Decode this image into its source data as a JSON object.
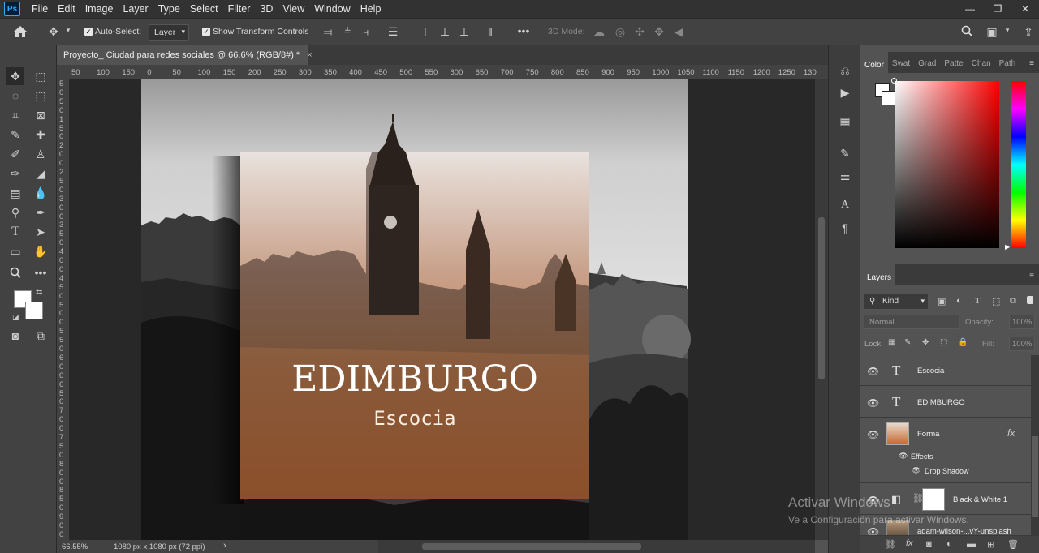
{
  "menubar": {
    "app_logo": "Ps",
    "items": [
      "File",
      "Edit",
      "Image",
      "Layer",
      "Type",
      "Select",
      "Filter",
      "3D",
      "View",
      "Window",
      "Help"
    ]
  },
  "options": {
    "auto_select_label": "Auto-Select:",
    "auto_select_value": "Layer",
    "show_transform_label": "Show Transform Controls",
    "mode_3d_label": "3D Mode:"
  },
  "document": {
    "tab_title": "Proyecto_ Ciudad para redes sociales @ 66.6% (RGB/8#) *",
    "close_glyph": "×",
    "zoom": "66.55%",
    "size_info": "1080 px x 1080 px (72 ppi)"
  },
  "ruler_h": [
    "50",
    "100",
    "150",
    "0",
    "50",
    "100",
    "150",
    "200",
    "250",
    "300",
    "350",
    "400",
    "450",
    "500",
    "550",
    "600",
    "650",
    "700",
    "750",
    "800",
    "850",
    "900",
    "950",
    "1000",
    "1050",
    "1100",
    "1150",
    "1200",
    "1250",
    "130"
  ],
  "ruler_v": [
    "5",
    "0",
    "5",
    "0",
    "1",
    "5",
    "0",
    "2",
    "0",
    "0",
    "2",
    "5",
    "0",
    "3",
    "0",
    "0",
    "3",
    "5",
    "0",
    "4",
    "0",
    "0",
    "4",
    "5",
    "0",
    "5",
    "0",
    "0",
    "5",
    "5",
    "0",
    "6",
    "0",
    "0",
    "6",
    "5",
    "0",
    "7",
    "0",
    "0",
    "7",
    "5",
    "0",
    "8",
    "0",
    "0",
    "8",
    "5",
    "0",
    "9",
    "0",
    "0"
  ],
  "artwork": {
    "title": "EDIMBURGO",
    "subtitle": "Escocia"
  },
  "color_panel": {
    "tabs": [
      "Color",
      "Swat",
      "Grad",
      "Patte",
      "Chan",
      "Path"
    ]
  },
  "layers_panel": {
    "title": "Layers",
    "filter_kind": "Kind",
    "blend_mode": "Normal",
    "opacity_label": "Opacity:",
    "opacity_value": "100%",
    "lock_label": "Lock:",
    "fill_label": "Fill:",
    "fill_value": "100%",
    "layers": [
      {
        "name": "Escocia",
        "type": "text"
      },
      {
        "name": "EDIMBURGO",
        "type": "text"
      },
      {
        "name": "Forma",
        "type": "shape",
        "fx": "fx"
      },
      {
        "name": "Black & White 1",
        "type": "adjustment"
      },
      {
        "name": "adam-wilson-...vY-unsplash",
        "type": "image"
      }
    ],
    "effects_label": "Effects",
    "drop_shadow_label": "Drop Shadow"
  },
  "watermark": {
    "line1": "Activar Windows",
    "line2": "Ve a Configuración para activar Windows."
  },
  "colors": {
    "orange_top": "#c89b80",
    "orange_bottom": "#c8682e",
    "accent": "#31a8ff"
  }
}
